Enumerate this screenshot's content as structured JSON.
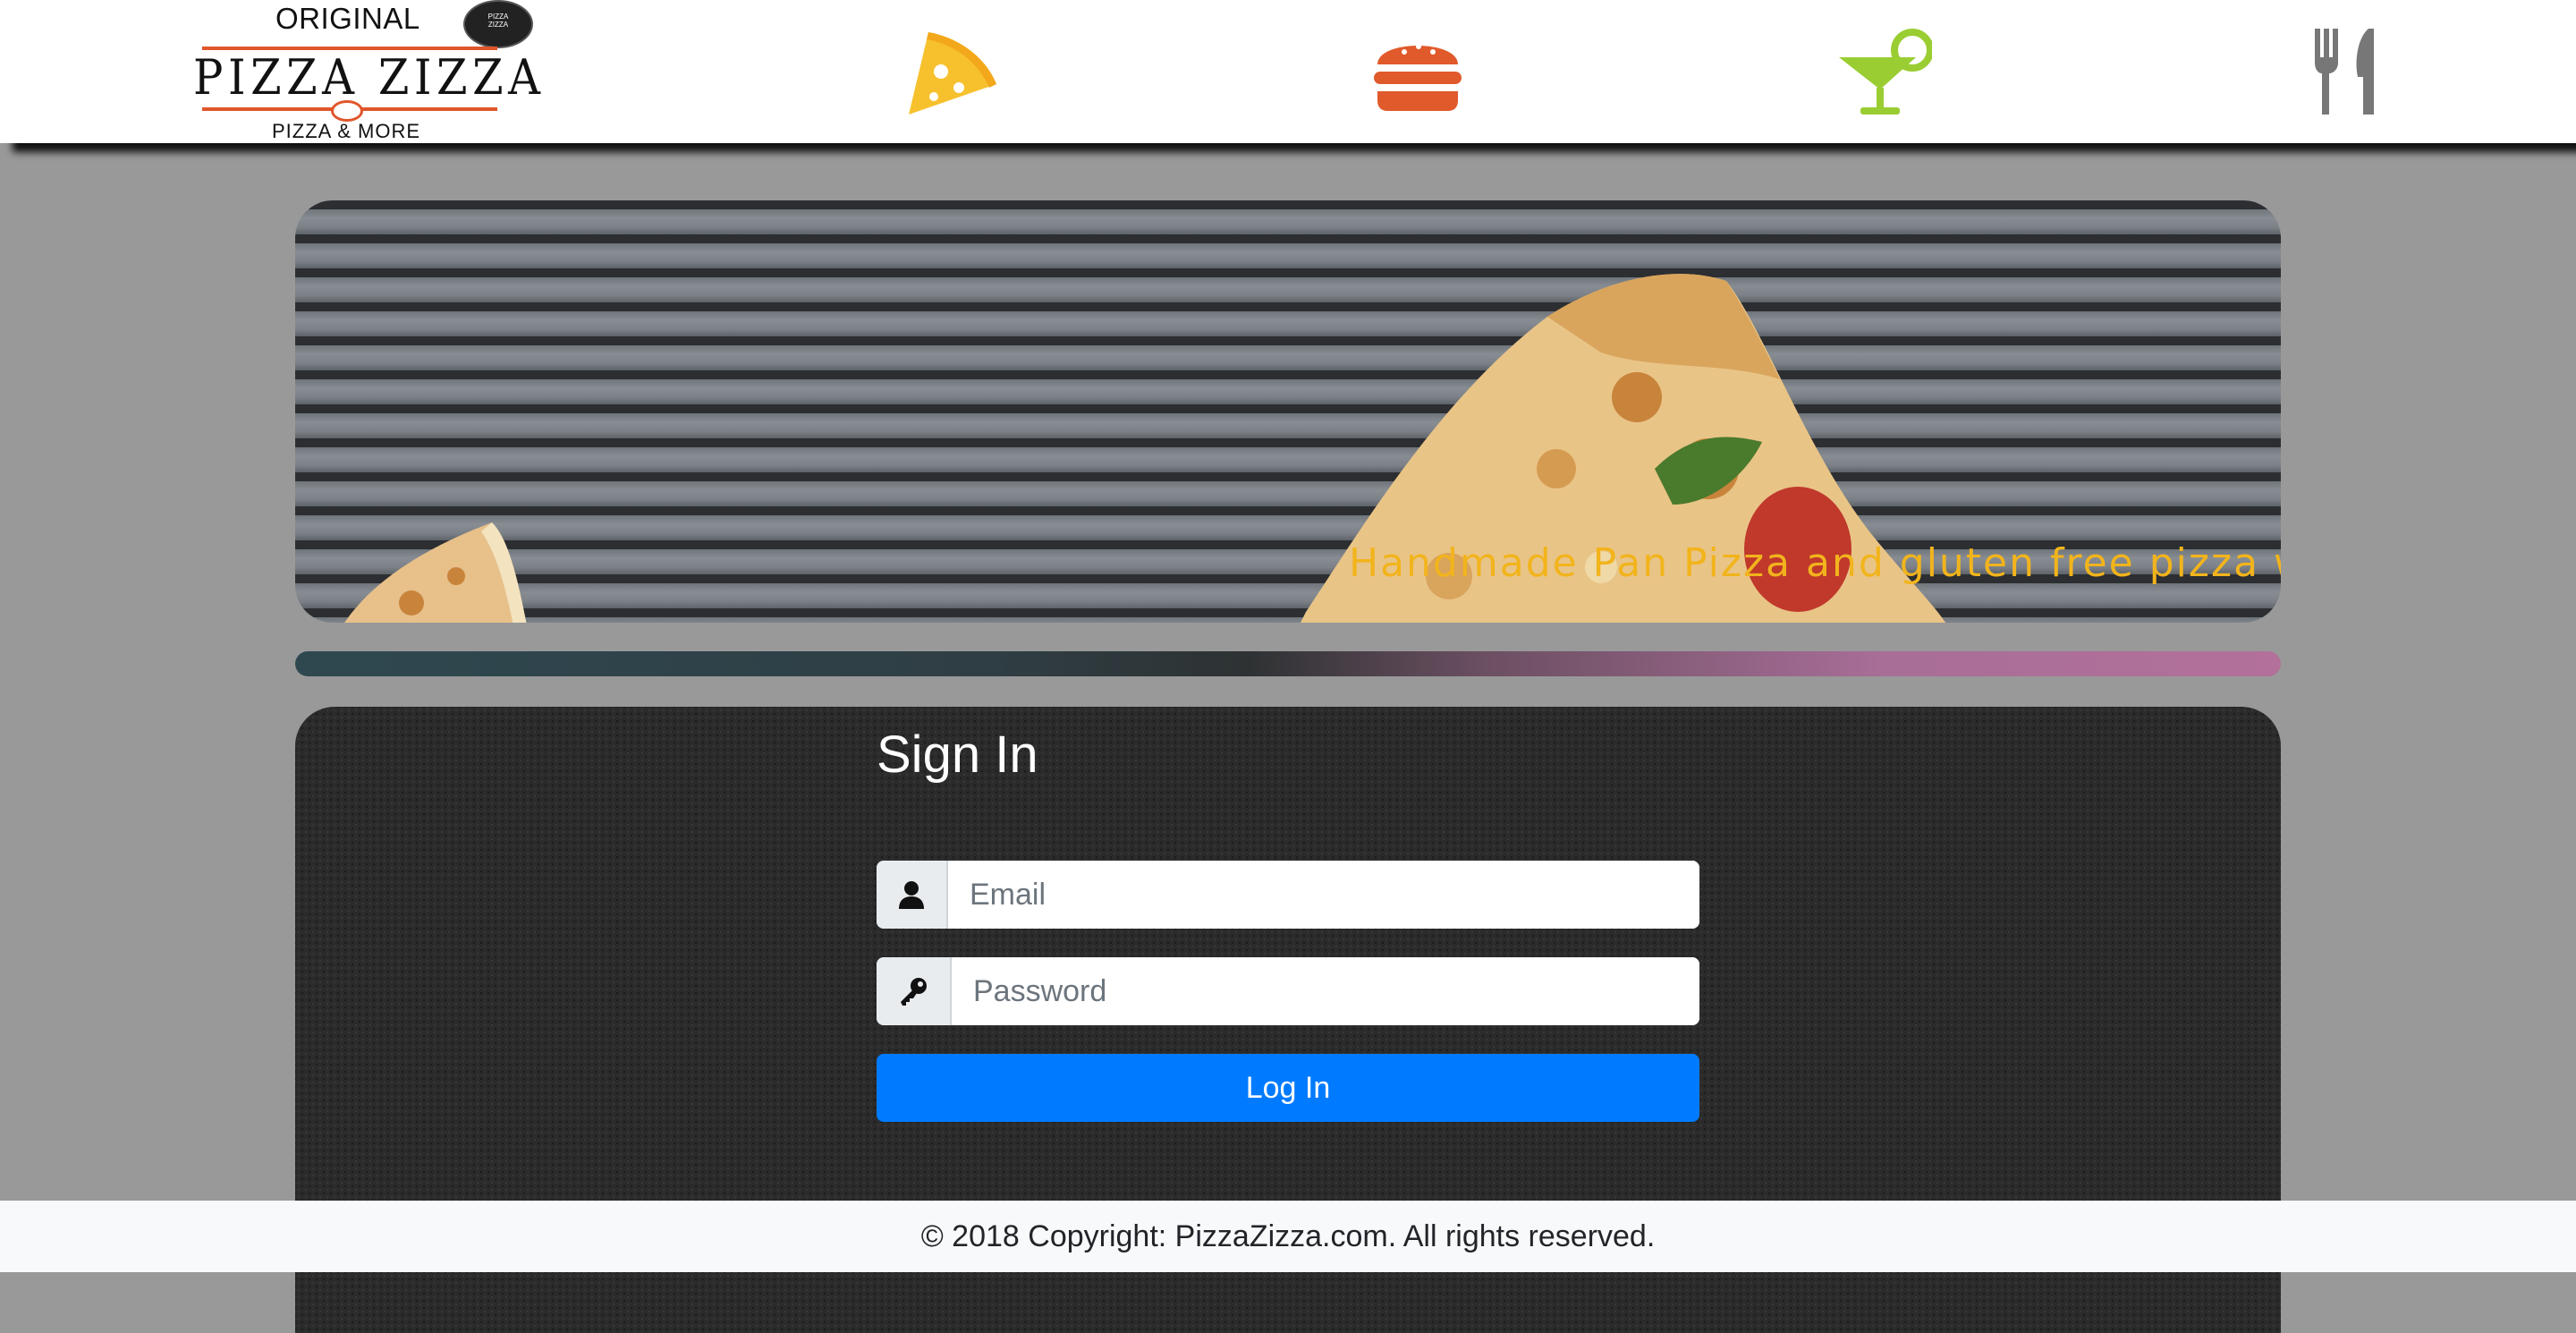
{
  "header": {
    "logo": {
      "top_text": "ORIGINAL",
      "main_text": "PIZZA ZIZZA",
      "sub_text": "PIZZA & MORE",
      "badge_text": "PIZZA ZIZZA"
    },
    "nav": [
      {
        "icon": "pizza-slice-icon",
        "color": "#f7c12e"
      },
      {
        "icon": "hamburger-icon",
        "color": "#e05a2b"
      },
      {
        "icon": "cocktail-icon",
        "color": "#9acd32"
      },
      {
        "icon": "utensils-icon",
        "color": "#777777"
      }
    ]
  },
  "banner": {
    "marquee_text": "Handmade Pan Pizza and gluten free pizza w",
    "text_color": "#f2b41c"
  },
  "signin": {
    "title": "Sign In",
    "email": {
      "placeholder": "Email",
      "value": "",
      "icon": "user-icon"
    },
    "password": {
      "placeholder": "Password",
      "value": "",
      "icon": "key-icon"
    },
    "login_label": "Log In",
    "button_color": "#007bff"
  },
  "footer": {
    "text": "© 2018 Copyright: PizzaZizza.com. All rights reserved."
  }
}
